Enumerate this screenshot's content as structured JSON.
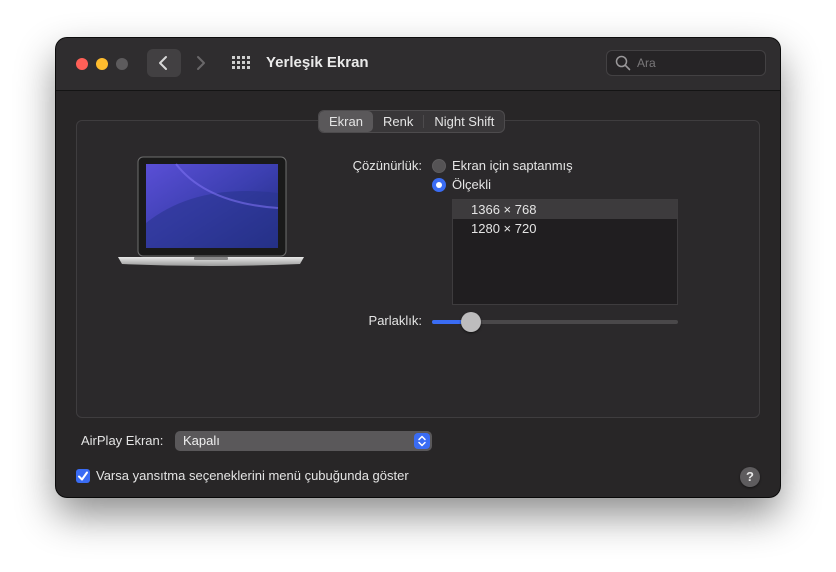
{
  "window": {
    "title": "Yerleşik Ekran",
    "search": {
      "placeholder": "Ara",
      "value": ""
    }
  },
  "tabs": [
    {
      "label": "Ekran",
      "active": true
    },
    {
      "label": "Renk",
      "active": false
    },
    {
      "label": "Night Shift",
      "active": false
    }
  ],
  "resolution": {
    "label": "Çözünürlük:",
    "options": [
      {
        "label": "Ekran için saptanmış",
        "selected": false
      },
      {
        "label": "Ölçekli",
        "selected": true
      }
    ],
    "list": [
      {
        "label": "1366 × 768",
        "selected": true
      },
      {
        "label": "1280 × 720",
        "selected": false
      }
    ]
  },
  "brightness": {
    "label": "Parlaklık:",
    "level": 0.16
  },
  "airplay": {
    "label": "AirPlay Ekran:",
    "value": "Kapalı"
  },
  "mirroring": {
    "label": "Varsa yansıtma seçeneklerini menü çubuğunda göster",
    "checked": true
  },
  "help": {
    "label": "?"
  },
  "colors": {
    "accent": "#3a6cf4",
    "window_bg": "#282627"
  },
  "icons": [
    "chevron-left-icon",
    "chevron-right-icon",
    "grid-icon",
    "search-icon",
    "laptop-icon",
    "select-arrows-icon",
    "checkmark-icon",
    "help-icon"
  ]
}
